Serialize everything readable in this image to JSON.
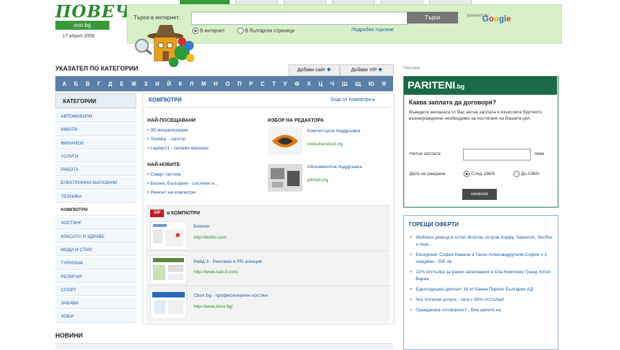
{
  "logo": {
    "text": "ПОВЕЧ",
    "badge": "ooo.bg",
    "date": "17 април 2008"
  },
  "search": {
    "label": "Търси в интернет:",
    "button": "Търси",
    "google_by": "powered by",
    "google": "Google",
    "options": [
      "В интернет",
      "В български страници"
    ],
    "advanced": "Подробно търсене"
  },
  "catalog": {
    "title": "УКАЗАТЕЛ ПО КАТЕГОРИИ",
    "add_site": "Добави сайт",
    "add_vip": "Добави VIP",
    "alphabet": [
      "А",
      "Б",
      "В",
      "Г",
      "Д",
      "Е",
      "Ж",
      "З",
      "И",
      "Й",
      "К",
      "Л",
      "М",
      "Н",
      "О",
      "П",
      "Р",
      "С",
      "Т",
      "У",
      "Ф",
      "Х",
      "Ц",
      "Ч",
      "Ш",
      "Щ",
      "Ю",
      "Я"
    ]
  },
  "sidebar": {
    "header": "КАТЕГОРИИ",
    "items": [
      "Автомобили",
      "Имоти",
      "Финанси",
      "Услуги",
      "Работа",
      "Електронни магазини",
      "Техника",
      "Компютри",
      "Хостинг",
      "Красота и здраве",
      "Мода и стил",
      "Туризъм",
      "Религия",
      "Спорт",
      "Забава",
      "Хоби"
    ],
    "active_index": 7
  },
  "main": {
    "title": "КОМПЮТРИ",
    "more": "Още от Компютри",
    "most_visited_title": "НАЙ-ПОСЕЩАВАНИ",
    "most_visited": [
      "3D визуализации",
      "Toshiba - лаптоп",
      "Laptop11 - онлайн магазин"
    ],
    "newest_title": "НАЙ-НОВИТЕ",
    "newest": [
      "Смарт систем",
      "Бизнес България - системи и...",
      "Ремонт на компютри"
    ],
    "editor_title": "ИЗБОР НА РЕДАКТОРА",
    "editor": [
      {
        "name": "Компютърна поддръжка",
        "url": "www.itservices.bg"
      },
      {
        "name": "Абонаментна поддръжка",
        "url": "q9mail.org"
      }
    ],
    "vip_tag": "VIP",
    "vip_title": "в КОМПЮТРИ",
    "vip": [
      {
        "name": "Бизони",
        "url": "http://bizimi.com"
      },
      {
        "name": "Райд 3 - Реклама и PR агенция",
        "url": "http://www.raid-3.com/"
      },
      {
        "name": "Cbox.bg - професионален хостинг",
        "url": "http://www.cbox.bg/"
      }
    ]
  },
  "news": {
    "title": "НОВИНИ"
  },
  "pariteni": {
    "ad_label": "Реклама",
    "logo": "PARITENI",
    "logo_suffix": ".bg",
    "subtitle": "Каква заплата да договоря?",
    "desc": "Въведете желаната от Вас нетна заплата и изчислете брутното възнаграждение необходимо за постигане на Вашата цел.",
    "amount_label": "Нетна заплата:",
    "amount_unit": "лева",
    "date_label": "Дата на раждане:",
    "options": [
      "След 1960г.",
      "До 1960г."
    ],
    "button": "изчисли"
  },
  "offers": {
    "title": "ГОРЕЩИ ОФЕРТИ",
    "items": [
      "Wellness уикенд в хотел Жгатна, остров Корфу, Закинтос, Лесбос и още...",
      "Екскурзия: София-Кавала и Тасос-Александруполи-София с 3 нощувки - 255 лв.",
      "22% отстъпка за ранни записвания в Спа Комплекс Гранд Хотел Варна",
      "Едногодишен депозит 16 от Банка Пиреос България АД",
      "№1 Хотелни услуги - сега с 50% отстъпка!",
      "Гражданска отговорност - Вие цените на"
    ]
  }
}
